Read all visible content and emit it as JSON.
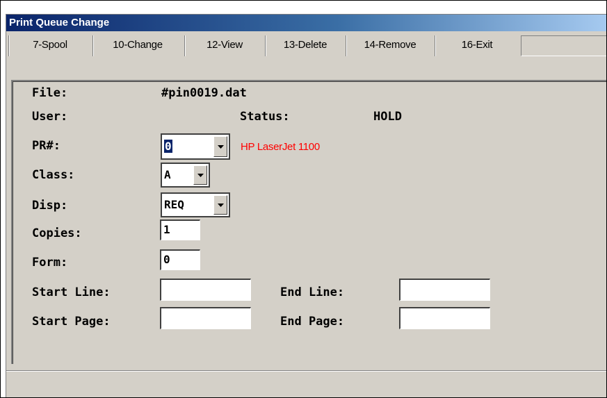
{
  "window": {
    "title": "Print Queue Change"
  },
  "toolbar": {
    "buttons": [
      "7-Spool",
      "10-Change",
      "12-View",
      "13-Delete",
      "14-Remove",
      "16-Exit"
    ]
  },
  "form": {
    "file_label": "File:",
    "file_value": "#pin0019.dat",
    "user_label": "User:",
    "user_value": "",
    "status_label": "Status:",
    "status_value": "HOLD",
    "pr_label": "PR#:",
    "pr_value": "0",
    "printer_name": "HP LaserJet 1100",
    "class_label": "Class:",
    "class_value": "A",
    "disp_label": "Disp:",
    "disp_value": "REQ",
    "copies_label": "Copies:",
    "copies_value": "1",
    "form_label": "Form:",
    "form_value": "0",
    "start_line_label": "Start Line:",
    "start_line_value": "",
    "end_line_label": "End Line:",
    "end_line_value": "",
    "start_page_label": "Start Page:",
    "start_page_value": "",
    "end_page_label": "End Page:",
    "end_page_value": ""
  },
  "icons": {
    "dropdown": "triangle-down-icon"
  }
}
